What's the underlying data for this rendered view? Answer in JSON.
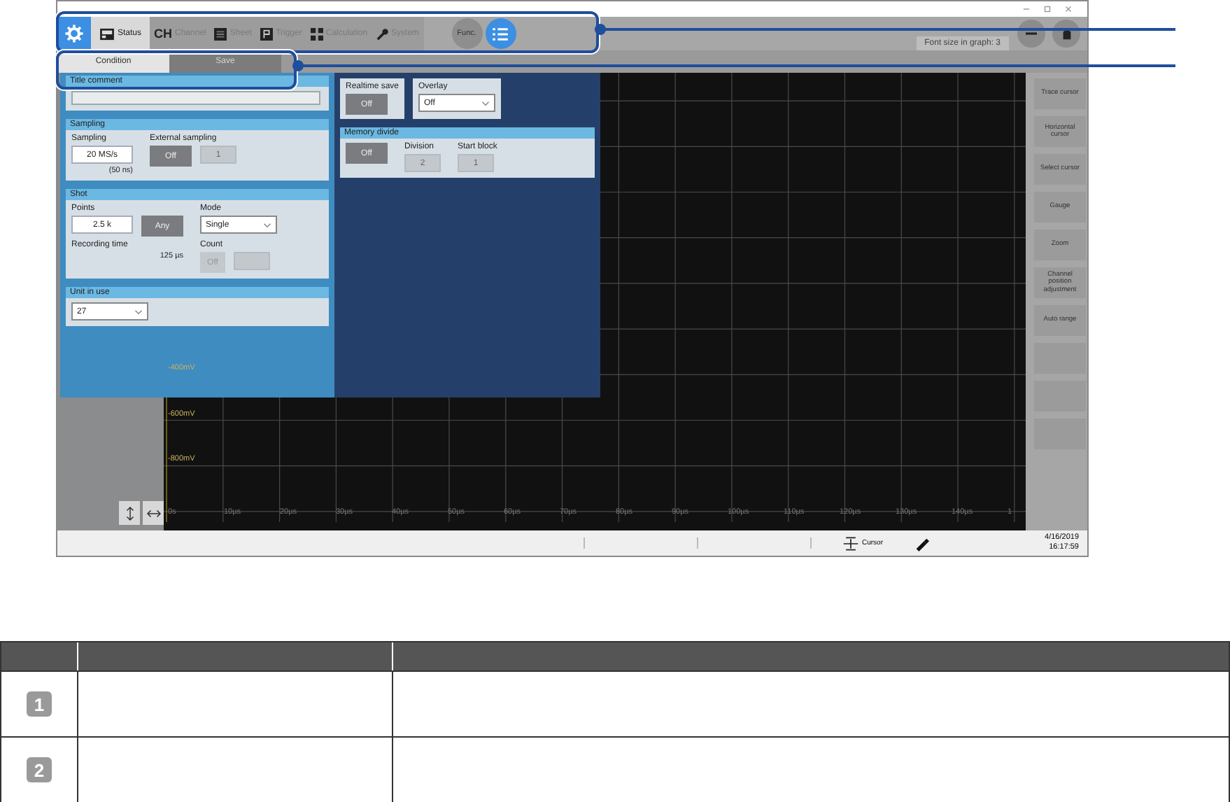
{
  "toolbar": {
    "tabs": [
      {
        "label": "Status",
        "selected": true
      },
      {
        "label": "Channel",
        "badge": "CH",
        "selected": false
      },
      {
        "label": "Sheet",
        "selected": false
      },
      {
        "label": "Trigger",
        "selected": false
      },
      {
        "label": "Calculation",
        "selected": false
      },
      {
        "label": "System",
        "selected": false
      }
    ],
    "func_button": "Func.",
    "font_size": "Font size in graph: 3"
  },
  "subtabs": [
    {
      "label": "Condition",
      "selected": true
    },
    {
      "label": "Save",
      "selected": false
    }
  ],
  "settings": {
    "left": [
      {
        "kind": "section",
        "title": "Title comment",
        "rows": [
          [
            {
              "controls": [
                {
                  "kind": "textbox",
                  "disabled": false
                }
              ]
            }
          ]
        ]
      },
      {
        "kind": "section",
        "title": "Sampling",
        "rows": [
          [
            {
              "label": "Sampling",
              "controls": [
                {
                  "kind": "field",
                  "value": "20 MS/s",
                  "disabled": false
                }
              ],
              "note": "(50 ns)"
            },
            {
              "label": "External sampling",
              "controls": [
                {
                  "kind": "button",
                  "value": "Off",
                  "disabled": false
                },
                {
                  "kind": "field",
                  "value": "1",
                  "disabled": true
                }
              ]
            }
          ]
        ]
      },
      {
        "kind": "section",
        "title": "Shot",
        "rows": [
          [
            {
              "label": "Points",
              "controls": [
                {
                  "kind": "field",
                  "value": "2.5 k",
                  "disabled": false
                },
                {
                  "kind": "button",
                  "value": "Any",
                  "disabled": false
                }
              ]
            },
            {
              "label": "Mode",
              "controls": [
                {
                  "kind": "dropdown",
                  "value": "Single",
                  "disabled": false
                }
              ]
            }
          ],
          [
            {
              "label": "Recording time",
              "note": "125 µs"
            },
            {
              "label": "Count",
              "controls": [
                {
                  "kind": "button",
                  "value": "Off",
                  "disabled": true
                },
                {
                  "kind": "field",
                  "disabled": true
                }
              ]
            }
          ]
        ]
      },
      {
        "kind": "section",
        "title": "Unit in use",
        "rows": [
          [
            {
              "controls": [
                {
                  "kind": "dropdown",
                  "value": "27",
                  "disabled": false
                }
              ]
            }
          ]
        ]
      }
    ],
    "right": [
      {
        "kind": "box",
        "rows": [
          [
            {
              "label": "Realtime save",
              "controls": [
                {
                  "kind": "button",
                  "value": "Off",
                  "disabled": false
                }
              ]
            }
          ]
        ]
      },
      {
        "kind": "box",
        "rows": [
          [
            {
              "label": "Overlay",
              "controls": [
                {
                  "kind": "dropdown",
                  "value": "Off",
                  "disabled": false
                }
              ]
            }
          ]
        ]
      },
      {
        "kind": "section",
        "title": "Memory divide",
        "rows": [
          [
            {
              "controls": [
                {
                  "kind": "button",
                  "value": "Off",
                  "disabled": false
                }
              ]
            },
            {
              "label": "Division",
              "controls": [
                {
                  "kind": "field",
                  "value": "2",
                  "disabled": true
                }
              ]
            },
            {
              "label": "Start block",
              "controls": [
                {
                  "kind": "field",
                  "value": "1",
                  "disabled": true
                }
              ]
            }
          ]
        ]
      }
    ]
  },
  "graph": {
    "y_labels": [
      "-400mV",
      "-600mV",
      "-800mV"
    ],
    "x_labels": [
      "0s",
      "10µs",
      "20µs",
      "30µs",
      "40µs",
      "50µs",
      "60µs",
      "70µs",
      "80µs",
      "90µs",
      "100µs",
      "110µs",
      "120µs",
      "130µs",
      "140µs",
      "1"
    ]
  },
  "sidebar": [
    {
      "kind": "text",
      "label": "Trace cursor"
    },
    {
      "kind": "text",
      "label": "Horizontal cursor"
    },
    {
      "kind": "text",
      "label": "Select cursor"
    },
    {
      "kind": "text",
      "label": "Gauge"
    },
    {
      "kind": "text",
      "label": "Zoom"
    },
    {
      "kind": "text",
      "label": "Channel position adjustment"
    },
    {
      "kind": "text",
      "label": "Auto range"
    },
    {
      "kind": "blank"
    },
    {
      "kind": "blank"
    },
    {
      "kind": "blank"
    }
  ],
  "status_bar": {
    "cursor_label": "Cursor",
    "date": "4/16/2019",
    "time": "16:17:59"
  },
  "table": {
    "rows": [
      {
        "number": "1"
      },
      {
        "number": "2"
      }
    ]
  }
}
